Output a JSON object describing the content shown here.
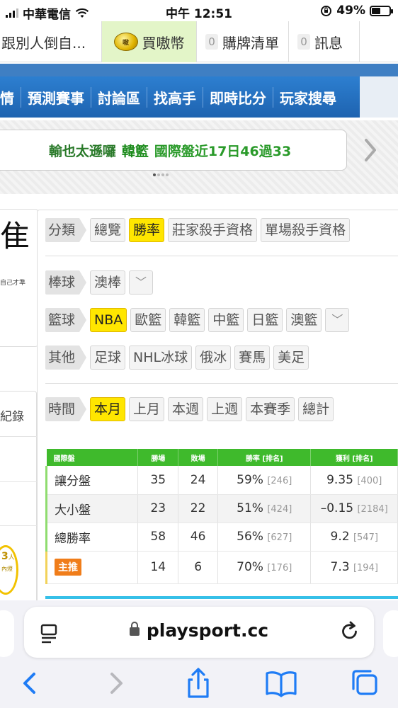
{
  "status_bar": {
    "carrier": "中華電信",
    "time": "中午 12:51",
    "battery_text": "49%",
    "battery_level": 0.49
  },
  "site_tabs": [
    {
      "label": "跟別人倒自..."
    },
    {
      "label": "買嗷幣",
      "coin_text": "嗷"
    },
    {
      "count": "0",
      "label": "購牌清單"
    },
    {
      "count": "0",
      "label": "訊息"
    }
  ],
  "main_nav": [
    "情",
    "預測賽事",
    "討論區",
    "找高手",
    "即時比分",
    "玩家搜尋"
  ],
  "ticker": {
    "part1": "輸也太遜囉",
    "part2": "韓籃",
    "part3": "國際盤近17日46過33"
  },
  "left_panel": {
    "big_char": "隹",
    "small_text": "自己才準",
    "record_label": "紀錄",
    "badge_number": "3",
    "badge_unit": "人",
    "badge_caption": "內燈"
  },
  "filters": {
    "category": {
      "label": "分類",
      "options": [
        "總覽",
        "勝率",
        "莊家殺手資格",
        "單場殺手資格"
      ],
      "active": "勝率"
    },
    "baseball": {
      "label": "棒球",
      "options": [
        "澳棒"
      ]
    },
    "basketball": {
      "label": "籃球",
      "options": [
        "NBA",
        "歐籃",
        "韓籃",
        "中籃",
        "日籃",
        "澳籃"
      ],
      "active": "NBA"
    },
    "other": {
      "label": "其他",
      "options": [
        "足球",
        "NHL冰球",
        "俄冰",
        "賽馬",
        "美足"
      ]
    },
    "time": {
      "label": "時間",
      "options": [
        "本月",
        "上月",
        "本週",
        "上週",
        "本賽季",
        "總計"
      ],
      "active": "本月"
    },
    "dropdown_glyph": "﹀"
  },
  "stats": {
    "headers": [
      "國際盤",
      "勝場",
      "敗場",
      "勝率 [排名]",
      "獲利 [排名]"
    ],
    "rows": [
      {
        "name": "讓分盤",
        "win": "35",
        "lose": "24",
        "rate": "59%",
        "rate_rank": "[246]",
        "profit": "9.35",
        "profit_rank": "[400]"
      },
      {
        "name": "大小盤",
        "win": "23",
        "lose": "22",
        "rate": "51%",
        "rate_rank": "[424]",
        "profit": "–0.15",
        "profit_rank": "[2184]"
      },
      {
        "name": "總勝率",
        "win": "58",
        "lose": "46",
        "rate": "56%",
        "rate_rank": "[627]",
        "profit": "9.2",
        "profit_rank": "[547]"
      },
      {
        "name": "主推",
        "win": "14",
        "lose": "6",
        "rate": "70%",
        "rate_rank": "[176]",
        "profit": "7.3",
        "profit_rank": "[194]"
      }
    ]
  },
  "browser": {
    "url": "playsport.cc"
  },
  "colors": {
    "nav_blue": "#1e63b0",
    "active_chip": "#ffe600",
    "table_header": "#3fba2c",
    "badge_orange": "#f07d1a",
    "ios_blue": "#1f7cf5"
  }
}
